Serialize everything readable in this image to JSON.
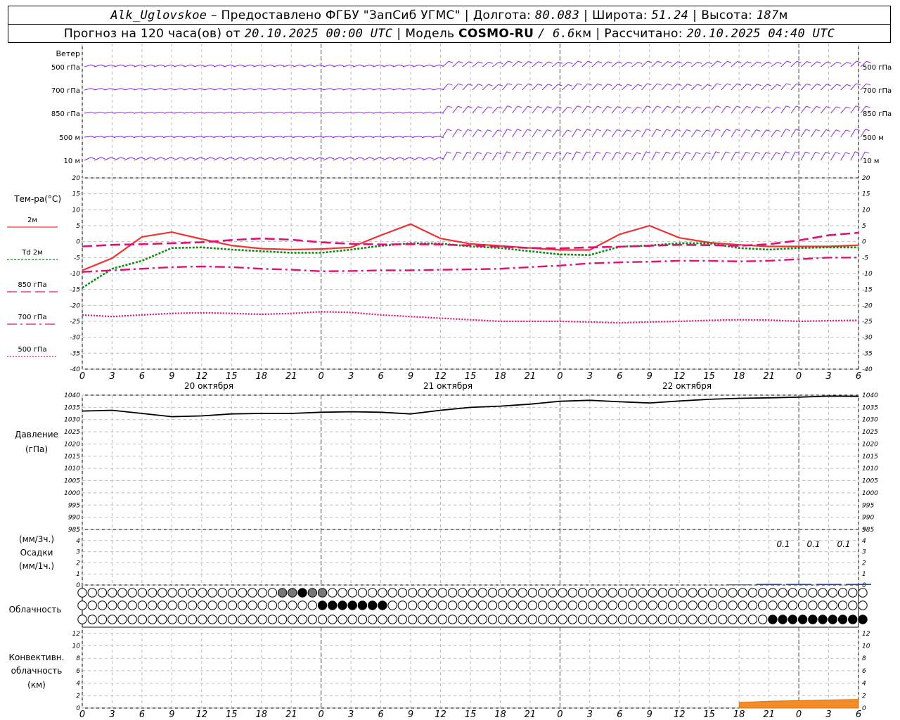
{
  "header": {
    "station": "Alk_Uglovskoe",
    "provider": "– Предоставлено ФГБУ \"ЗапСиб УГМС\"",
    "lon_label": "Долгота:",
    "lon_value": "80.083",
    "lat_label": "Широта:",
    "lat_value": "51.24",
    "alt_label": "Высота:",
    "alt_value": "187",
    "alt_unit": "м",
    "forecast_label": "Прогноз на 120 часа(ов) от",
    "forecast_start": "20.10.2025 00:00 UTC",
    "model_label": "Модель",
    "model_name": "COSMO-RU",
    "model_res": "/ 6.6",
    "model_res_unit": "км",
    "calc_label": "Рассчитано:",
    "calc_time": "20.10.2025 04:40 UTC"
  },
  "wind_panel": {
    "title": "Ветер",
    "levels": [
      "500 гПа",
      "700 гПа",
      "850 гПа",
      "500 м",
      "10 м"
    ],
    "color": "#8a2be2"
  },
  "temp_panel": {
    "title": "Тем-ра(°С)",
    "legend": [
      {
        "label": "2м",
        "color": "#ee3333",
        "style": "solid"
      },
      {
        "label": "Td 2м",
        "color": "#118811",
        "style": "dotted"
      },
      {
        "label": "850 гПа",
        "color": "#dd1177",
        "style": "dash"
      },
      {
        "label": "700 гПа",
        "color": "#dd1177",
        "style": "dashdot"
      },
      {
        "label": "500 гПа",
        "color": "#dd1177",
        "style": "fine-dot"
      }
    ],
    "ticks": [
      "20",
      "15",
      "10",
      "5",
      "0",
      "-5",
      "-10",
      "-15",
      "-20",
      "-25",
      "-30",
      "-35",
      "-40"
    ]
  },
  "time_axis": {
    "hour_labels": [
      "0",
      "3",
      "6",
      "9",
      "12",
      "15",
      "18",
      "21",
      "0",
      "3",
      "6",
      "9",
      "12",
      "15",
      "18",
      "21",
      "0",
      "3",
      "6",
      "9",
      "12",
      "15",
      "18",
      "21",
      "0",
      "3",
      "6"
    ],
    "dates": [
      "20 октября",
      "21 октября",
      "22 октября"
    ]
  },
  "pressure_panel": {
    "title": "Давление",
    "unit": "(гПа)",
    "ticks": [
      "1040",
      "1035",
      "1030",
      "1025",
      "1020",
      "1015",
      "1010",
      "1005",
      "1000",
      "995",
      "990",
      "985"
    ]
  },
  "precip_panel": {
    "unit_top": "(мм/3ч.)",
    "title": "Осадки",
    "unit_bottom": "(мм/1ч.)",
    "ticks": [
      "5",
      "4",
      "3",
      "2",
      "1",
      "0"
    ],
    "annotations": [
      "0.1",
      "0.1",
      "0.1"
    ]
  },
  "cloud_panel": {
    "title": "Облачность"
  },
  "conv_panel": {
    "title_1": "Конвективн.",
    "title_2": "облачность",
    "unit": "(км)",
    "ticks": [
      "12",
      "10",
      "8",
      "6",
      "4",
      "2",
      "0"
    ]
  },
  "chart_data": [
    {
      "type": "line",
      "title": "Тем-ра(°С)",
      "x_unit": "hours since 20.10.2025 00:00 UTC",
      "x": [
        0,
        3,
        6,
        9,
        12,
        15,
        18,
        21,
        24,
        27,
        30,
        33,
        36,
        39,
        42,
        45,
        48,
        51,
        54,
        57,
        60,
        63,
        66,
        69,
        72,
        75,
        78
      ],
      "ylim": [
        -40,
        20
      ],
      "series": [
        {
          "name": "2м",
          "values": [
            -9,
            -5.2,
            1.5,
            3,
            0.8,
            -1.2,
            -2.2,
            -2.5,
            -2.3,
            -1.8,
            2,
            5.5,
            1,
            -0.7,
            -1.3,
            -2,
            -2.6,
            -2.6,
            2.3,
            5,
            1.2,
            -0.3,
            -1,
            -1.5,
            -1.5,
            -1.5,
            -1.1
          ]
        },
        {
          "name": "Td 2м",
          "values": [
            -14.5,
            -8.5,
            -6,
            -2,
            -1.8,
            -2.5,
            -3,
            -3.5,
            -3.5,
            -2.5,
            -1.3,
            -0.5,
            -0.6,
            -1.5,
            -2,
            -3,
            -4,
            -4.2,
            -1.6,
            -1.2,
            -0.5,
            -0.5,
            -2,
            -2.5,
            -2,
            -1.8,
            -1.8
          ]
        },
        {
          "name": "850 гПа",
          "values": [
            -1.5,
            -1,
            -0.8,
            -0.5,
            -0.2,
            0.5,
            1,
            0.6,
            -0.2,
            -0.7,
            -0.9,
            -0.8,
            -0.9,
            -1.2,
            -1.6,
            -2,
            -2.1,
            -1.8,
            -1.6,
            -1.3,
            -1,
            -1.1,
            -1.3,
            -0.8,
            0.4,
            2,
            2.8
          ]
        },
        {
          "name": "700 гПа",
          "values": [
            -9.5,
            -9,
            -8.5,
            -8,
            -7.8,
            -8,
            -8.5,
            -8.8,
            -9.3,
            -9.2,
            -9,
            -9,
            -8.8,
            -8.7,
            -8.5,
            -8,
            -7.5,
            -6.8,
            -6.5,
            -6.3,
            -6,
            -6,
            -6.2,
            -6,
            -5.5,
            -5,
            -5
          ]
        },
        {
          "name": "500 гПа",
          "values": [
            -23,
            -23.5,
            -23,
            -22.5,
            -22.3,
            -22.5,
            -22.8,
            -22.5,
            -22,
            -22.2,
            -23,
            -23.5,
            -24,
            -24.5,
            -25,
            -25,
            -25,
            -25.2,
            -25.5,
            -25.2,
            -25,
            -24.7,
            -24.5,
            -24.6,
            -25,
            -24.8,
            -24.7
          ]
        }
      ]
    },
    {
      "type": "line",
      "title": "Давление",
      "ylabel": "(гПа)",
      "x": [
        0,
        3,
        6,
        9,
        12,
        15,
        18,
        21,
        24,
        27,
        30,
        33,
        36,
        39,
        42,
        45,
        48,
        51,
        54,
        57,
        60,
        63,
        66,
        69,
        72,
        75,
        78
      ],
      "ylim": [
        985,
        1040
      ],
      "series": [
        {
          "name": "",
          "values": [
            1033.5,
            1033.8,
            1032.5,
            1031.2,
            1031.5,
            1032.3,
            1032.5,
            1032.5,
            1033,
            1033.2,
            1033,
            1032.3,
            1033.8,
            1035,
            1035.5,
            1036.3,
            1037.5,
            1037.9,
            1037.3,
            1036.8,
            1037.6,
            1038.3,
            1038.7,
            1038.9,
            1039.2,
            1039.6,
            1039.5
          ]
        }
      ]
    },
    {
      "type": "bar",
      "title": "Осадки",
      "ylabel": "(мм/3ч.)",
      "x": [
        66,
        69,
        72,
        75,
        78
      ],
      "values": [
        0.05,
        0.1,
        0.1,
        0.1,
        0.1
      ],
      "ylim": [
        0,
        5
      ]
    },
    {
      "type": "area",
      "title": "Конвективн. облачность",
      "ylabel": "(км)",
      "x": [
        66,
        69,
        72,
        75,
        78
      ],
      "values": [
        0.9,
        1.1,
        1.2,
        1.3,
        1.4
      ],
      "ylim": [
        0,
        13
      ]
    }
  ]
}
